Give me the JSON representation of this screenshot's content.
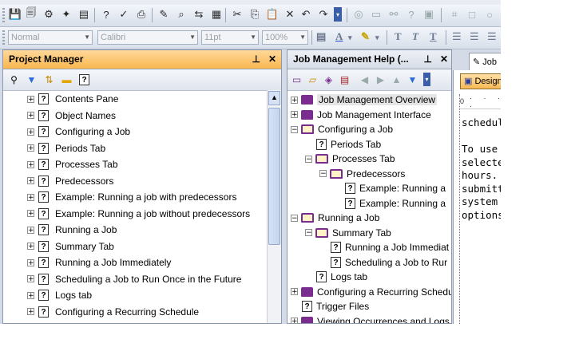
{
  "formatting": {
    "style": "Normal",
    "font": "Calibri",
    "size": "11pt",
    "zoom": "100%"
  },
  "project_manager": {
    "title": "Project Manager",
    "items": [
      "Contents Pane",
      "Object Names",
      "Configuring a Job",
      "Periods Tab",
      "Processes Tab",
      "Predecessors",
      "Example: Running a job with predecessors",
      "Example: Running a job without predecessors",
      "Running a Job",
      "Summary Tab",
      "Running a Job Immediately",
      "Scheduling a Job to Run Once in the Future",
      "Logs tab",
      "Configuring a Recurring Schedule"
    ]
  },
  "help_panel": {
    "title": "Job Management Help (...",
    "tree": [
      "Job Management Overview",
      "Job Management Interface",
      "Configuring a Job",
      "Periods Tab",
      "Processes Tab",
      "Predecessors",
      "Example: Running a",
      "Example: Running a",
      "Running a Job",
      "Summary Tab",
      "Running a Job Immediat",
      "Scheduling a Job to Rur",
      "Logs tab",
      "Configuring a Recurring Schedul",
      "Trigger Files",
      "Viewing Occurrences and Logs I"
    ]
  },
  "document": {
    "tab_label": "Job",
    "design_label": "Design",
    "ruler_zero": "0",
    "lines": [
      "schedul",
      "",
      "To use t",
      "selecte",
      "hours. T",
      "submitt",
      "system",
      "options"
    ]
  },
  "icons": {
    "accent_active_header": "#f9b74e",
    "book_color": "#7b2c8f"
  }
}
